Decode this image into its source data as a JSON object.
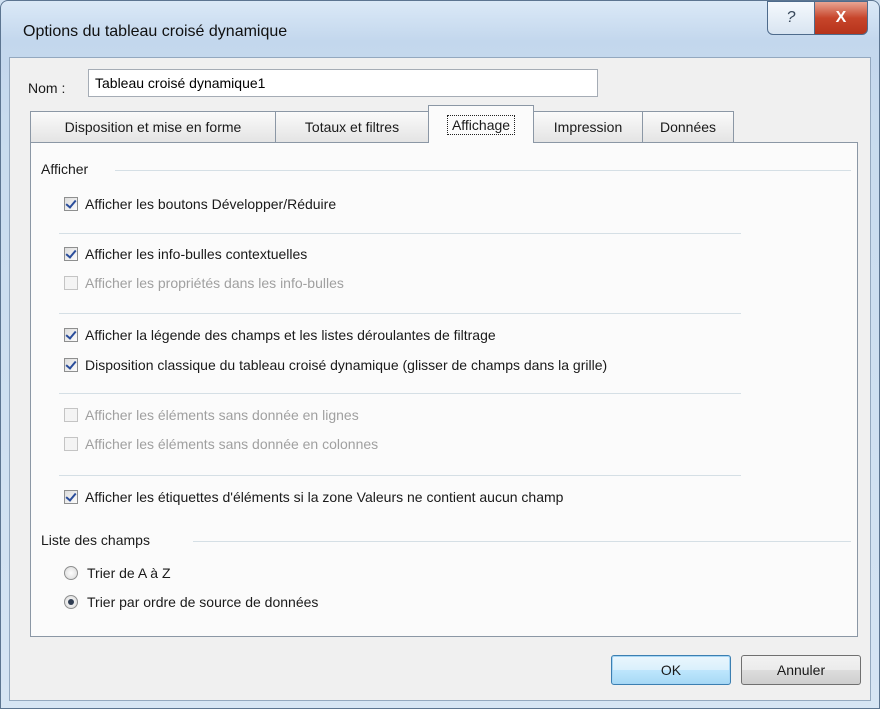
{
  "window": {
    "title": "Options du tableau croisé dynamique",
    "help_glyph": "?",
    "close_glyph": "X"
  },
  "name_field": {
    "label": "Nom :",
    "value": "Tableau croisé dynamique1"
  },
  "tabs": [
    {
      "label": "Disposition et mise en forme",
      "active": false
    },
    {
      "label": "Totaux et filtres",
      "active": false
    },
    {
      "label": "Affichage",
      "active": true
    },
    {
      "label": "Impression",
      "active": false
    },
    {
      "label": "Données",
      "active": false
    }
  ],
  "display_section": {
    "title": "Afficher",
    "options": [
      {
        "label": "Afficher les boutons Développer/Réduire",
        "checked": true,
        "enabled": true
      },
      {
        "label": "Afficher les info-bulles contextuelles",
        "checked": true,
        "enabled": true
      },
      {
        "label": "Afficher les propriétés dans les info-bulles",
        "checked": false,
        "enabled": false
      },
      {
        "label": "Afficher la légende des champs et les listes déroulantes de filtrage",
        "checked": true,
        "enabled": true
      },
      {
        "label": "Disposition classique du tableau croisé dynamique (glisser de champs dans la grille)",
        "checked": true,
        "enabled": true
      },
      {
        "label": "Afficher les éléments sans donnée en lignes",
        "checked": false,
        "enabled": false
      },
      {
        "label": "Afficher les éléments sans donnée en colonnes",
        "checked": false,
        "enabled": false
      },
      {
        "label": "Afficher les étiquettes d'éléments si la zone Valeurs ne contient aucun champ",
        "checked": true,
        "enabled": true
      }
    ]
  },
  "field_list_section": {
    "title": "Liste des champs",
    "options": [
      {
        "label": "Trier de A à Z",
        "selected": false
      },
      {
        "label": "Trier par ordre de source de données",
        "selected": true
      }
    ]
  },
  "buttons": {
    "ok": "OK",
    "cancel": "Annuler"
  }
}
